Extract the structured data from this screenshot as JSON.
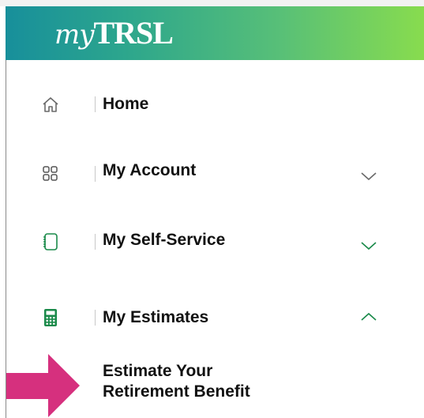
{
  "header": {
    "logo_my": "my",
    "logo_trsl": "TRSL",
    "gradient_start": "#178f9b",
    "gradient_end": "#88dc4e"
  },
  "nav": {
    "items": [
      {
        "label": "Home",
        "icon": "home-icon",
        "expanded": null
      },
      {
        "label": "My Account",
        "icon": "grid-icon",
        "expanded": false
      },
      {
        "label": "My Self-Service",
        "icon": "notebook-icon",
        "expanded": false
      },
      {
        "label": "My Estimates",
        "icon": "calculator-icon",
        "expanded": true
      }
    ],
    "subitems": {
      "estimate_line1": "Estimate Your",
      "estimate_line2": "Retirement Benefit"
    }
  },
  "colors": {
    "icon_green": "#1a8a4a",
    "chevron": "#6a6a6a",
    "arrow": "#d6307e"
  }
}
